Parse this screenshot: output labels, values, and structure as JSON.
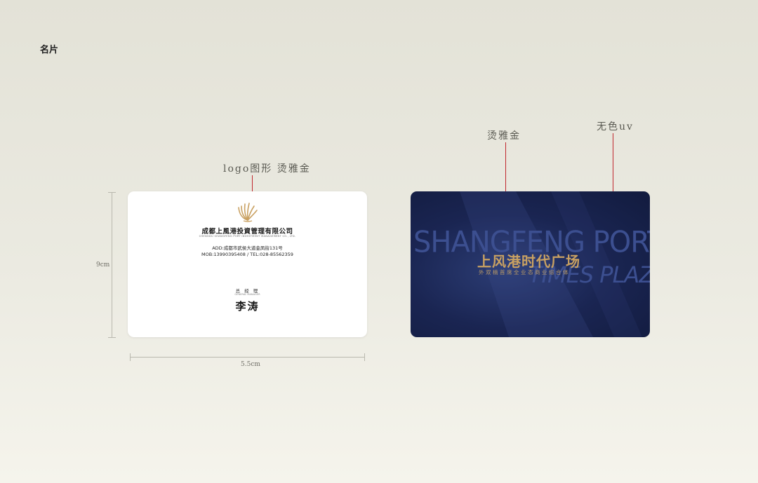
{
  "page": {
    "title": "名片"
  },
  "annotations": {
    "logo_note": "logo图形 烫雅金",
    "gold_note": "烫雅金",
    "uv_note": "无色uv"
  },
  "dimensions": {
    "height_label": "9cm",
    "width_label": "5.5cm"
  },
  "front_card": {
    "company_cn": "成都上風港投資管理有限公司",
    "company_en": "CHENGDU SHANGFENG PORT INVESTMENT MANAGEMENT CO., LTD.",
    "address": "ADD:成都市武侯大道金凤街131号",
    "phones": "MOB:13990395408   /   TEL:028-85562359",
    "job_title_cn": "总 经 理",
    "job_title_en": "GENERAL MANAGER",
    "name": "李涛"
  },
  "back_card": {
    "brand_cn": "上风港时代广场",
    "brand_sub": "外双楠首席全业态商业综合体",
    "bg_text_line1": "SHANGFENG PORT",
    "bg_text_line2": "TIMES PLAZA"
  },
  "colors": {
    "accent_red": "#c0262d",
    "gold": "#c9a162",
    "card_navy": "#1a2552"
  }
}
